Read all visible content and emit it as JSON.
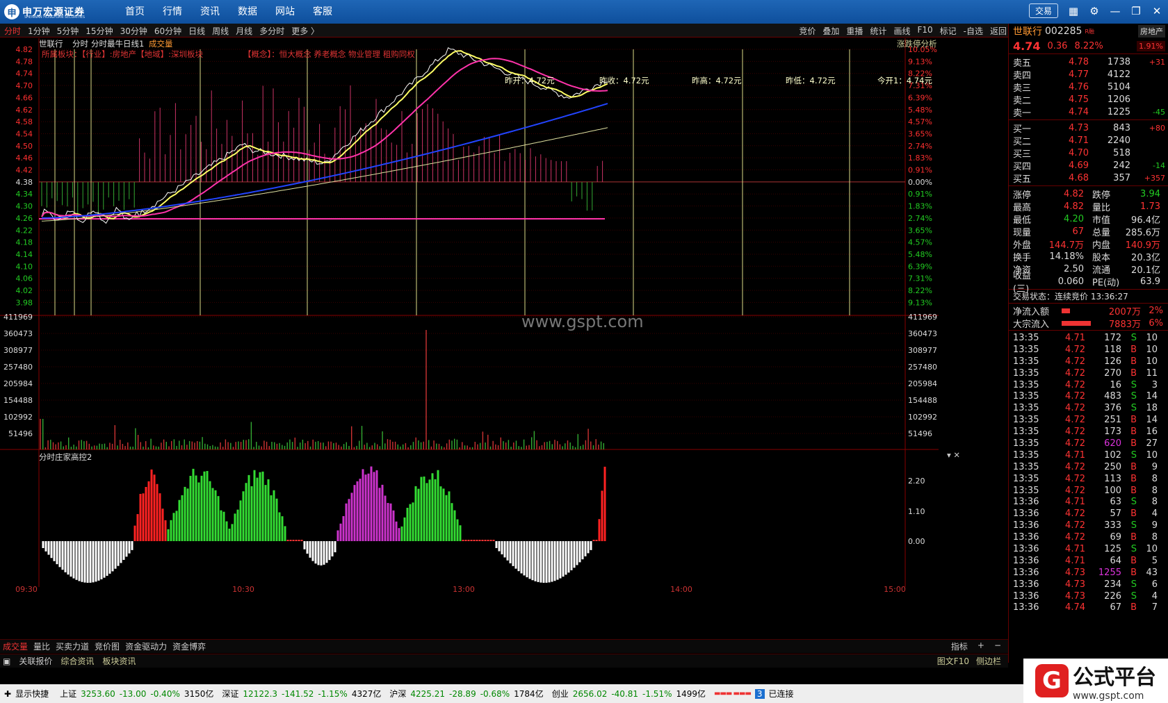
{
  "app": {
    "logo_text": "申万宏源证券",
    "logo_sub": "SHENWAN HONGYUAN SECURITIES",
    "nav": [
      "首页",
      "行情",
      "资讯",
      "数据",
      "网站",
      "客服"
    ],
    "trade_btn": "交易"
  },
  "toolbar": {
    "periods": [
      "分时",
      "1分钟",
      "5分钟",
      "15分钟",
      "30分钟",
      "60分钟",
      "日线",
      "周线",
      "月线",
      "多分时",
      "更多 〉"
    ],
    "tools": [
      "竞价",
      "叠加",
      "重播",
      "统计",
      "画线",
      "F10",
      "标记",
      "-自选",
      "返回"
    ]
  },
  "chart_header": {
    "stock": "世联行",
    "mode": "分时",
    "indicator": "分时最牛日线1",
    "vol_label": "成交量",
    "sector_line": "所属板块：【行业】:房地产【地域】:深圳板块",
    "concept_line": "【概念】：恒大概念 养老概念 物业管理 租购同权",
    "zd_analysis": "涨跌停分析"
  },
  "price_info": {
    "open": "昨开：4.72元",
    "close": "昨收：4.72元",
    "high": "昨高：4.72元",
    "low": "昨低：4.72元",
    "today_open": "今开1：4.74元"
  },
  "watermark": "www.gspt.com",
  "indicator_panel": {
    "title": "分时庄家高控2",
    "right_labels": [
      "2.20",
      "1.10",
      "0.00"
    ]
  },
  "time_axis": [
    "09:30",
    "10:30",
    "13:00",
    "14:00",
    "15:00"
  ],
  "price_ticks": [
    "4.82",
    "4.78",
    "4.74",
    "4.70",
    "4.66",
    "4.62",
    "4.58",
    "4.54",
    "4.50",
    "4.46",
    "4.42",
    "4.38",
    "4.34",
    "4.30",
    "4.26",
    "4.22",
    "4.18",
    "4.14",
    "4.10",
    "4.06",
    "4.02",
    "3.98"
  ],
  "pct_ticks": [
    "10.05%",
    "9.13%",
    "8.22%",
    "7.31%",
    "6.39%",
    "5.48%",
    "4.57%",
    "3.65%",
    "2.74%",
    "1.83%",
    "0.91%",
    "0.00%",
    "0.91%",
    "1.83%",
    "2.74%",
    "3.65%",
    "4.57%",
    "5.48%",
    "6.39%",
    "7.31%",
    "8.22%",
    "9.13%"
  ],
  "vol_ticks": [
    "411969",
    "360473",
    "308977",
    "257480",
    "205984",
    "154488",
    "102992",
    "51496"
  ],
  "bottom_tabs": [
    "成交量",
    "量比",
    "买卖力道",
    "竞价图",
    "资金驱动力",
    "资金博弈"
  ],
  "bottom_right": [
    "指标",
    "+",
    "−"
  ],
  "bottom_links": [
    "关联报价",
    "综合资讯",
    "板块资讯"
  ],
  "bottom_links_right": [
    "图文F10",
    "侧边栏"
  ],
  "quote": {
    "name": "世联行",
    "code": "002285",
    "rtag": "R融",
    "sector": "房地产",
    "price": "4.74",
    "change": "0.36",
    "pct": "8.22%",
    "sector_pct": "1.91%",
    "asks": [
      [
        "卖五",
        "4.78",
        "1738",
        "+31"
      ],
      [
        "卖四",
        "4.77",
        "4122",
        ""
      ],
      [
        "卖三",
        "4.76",
        "5104",
        ""
      ],
      [
        "卖二",
        "4.75",
        "1206",
        ""
      ],
      [
        "卖一",
        "4.74",
        "1225",
        "-45"
      ]
    ],
    "bids": [
      [
        "买一",
        "4.73",
        "843",
        "+80"
      ],
      [
        "买二",
        "4.71",
        "2240",
        ""
      ],
      [
        "买三",
        "4.70",
        "518",
        ""
      ],
      [
        "买四",
        "4.69",
        "242",
        "-14"
      ],
      [
        "买五",
        "4.68",
        "357",
        "+357"
      ]
    ],
    "stats": [
      [
        "涨停",
        "4.82",
        "跌停",
        "3.94"
      ],
      [
        "最高",
        "4.82",
        "量比",
        "1.73"
      ],
      [
        "最低",
        "4.20",
        "市值",
        "96.4亿"
      ],
      [
        "现量",
        "67",
        "总量",
        "285.6万"
      ],
      [
        "外盘",
        "144.7万",
        "内盘",
        "140.9万"
      ],
      [
        "换手",
        "14.18%",
        "股本",
        "20.3亿"
      ],
      [
        "净资",
        "2.50",
        "流通",
        "20.1亿"
      ],
      [
        "收益(三)",
        "0.060",
        "PE(动)",
        "63.9"
      ]
    ],
    "trade_state": "交易状态：连续竞价 13:36:27",
    "flows": [
      [
        "净流入额",
        "2007万",
        "2%"
      ],
      [
        "大宗流入",
        "7883万",
        "6%"
      ]
    ],
    "ticks": [
      [
        "13:35",
        "4.71",
        "172",
        "S",
        "10"
      ],
      [
        "13:35",
        "4.72",
        "118",
        "B",
        "10"
      ],
      [
        "13:35",
        "4.72",
        "126",
        "B",
        "10"
      ],
      [
        "13:35",
        "4.72",
        "270",
        "B",
        "11"
      ],
      [
        "13:35",
        "4.72",
        "16",
        "S",
        "3"
      ],
      [
        "13:35",
        "4.72",
        "483",
        "S",
        "14"
      ],
      [
        "13:35",
        "4.72",
        "376",
        "S",
        "18"
      ],
      [
        "13:35",
        "4.72",
        "251",
        "B",
        "14"
      ],
      [
        "13:35",
        "4.72",
        "173",
        "B",
        "16"
      ],
      [
        "13:35",
        "4.72",
        "620",
        "B",
        "27"
      ],
      [
        "13:35",
        "4.71",
        "102",
        "S",
        "10"
      ],
      [
        "13:35",
        "4.72",
        "250",
        "B",
        "9"
      ],
      [
        "13:35",
        "4.72",
        "113",
        "B",
        "8"
      ],
      [
        "13:35",
        "4.72",
        "100",
        "B",
        "8"
      ],
      [
        "13:36",
        "4.71",
        "63",
        "S",
        "8"
      ],
      [
        "13:36",
        "4.72",
        "57",
        "B",
        "4"
      ],
      [
        "13:36",
        "4.72",
        "333",
        "S",
        "9"
      ],
      [
        "13:36",
        "4.72",
        "69",
        "B",
        "8"
      ],
      [
        "13:36",
        "4.71",
        "125",
        "S",
        "10"
      ],
      [
        "13:36",
        "4.71",
        "64",
        "B",
        "5"
      ],
      [
        "13:36",
        "4.73",
        "1255",
        "B",
        "43"
      ],
      [
        "13:36",
        "4.73",
        "234",
        "S",
        "6"
      ],
      [
        "13:36",
        "4.73",
        "226",
        "S",
        "4"
      ],
      [
        "13:36",
        "4.74",
        "67",
        "B",
        "7"
      ]
    ]
  },
  "status": {
    "shortcut": "显示快捷",
    "indices": [
      [
        "上证",
        "3253.60",
        "-13.00",
        "-0.40%",
        "3150亿"
      ],
      [
        "深证",
        "12122.3",
        "-141.52",
        "-1.15%",
        "4327亿"
      ],
      [
        "沪深",
        "4225.21",
        "-28.89",
        "-0.68%",
        "1784亿"
      ],
      [
        "创业",
        "2656.02",
        "-40.81",
        "-1.51%",
        "1499亿"
      ]
    ],
    "conn_count": "3",
    "conn": "已连接"
  },
  "brand": {
    "name": "公式平台",
    "url": "www.gspt.com"
  },
  "colors": {
    "up": "#ff3030",
    "down": "#22cc22",
    "yellow": "#ffff66",
    "magenta": "#ff33aa",
    "blue": "#2244ff"
  }
}
